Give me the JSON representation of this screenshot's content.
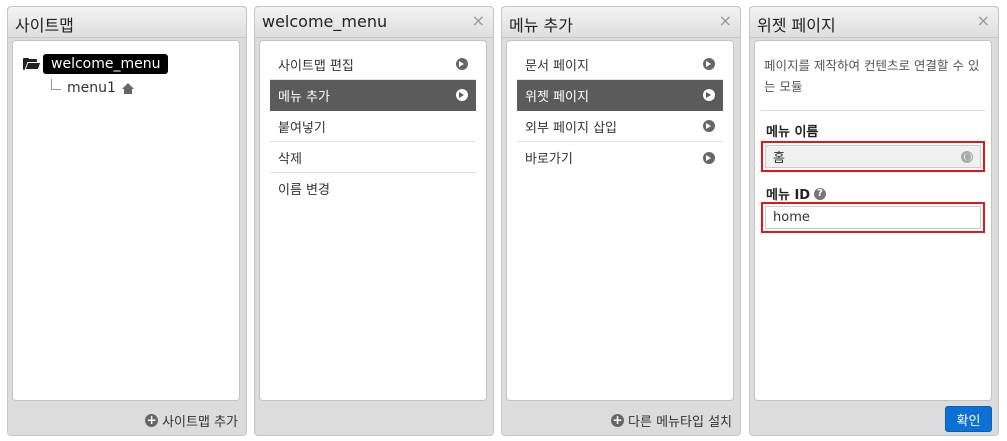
{
  "sitemap": {
    "title": "사이트맵",
    "root_label": "welcome_menu",
    "child_label": "menu1",
    "footer_action": "사이트맵 추가"
  },
  "welcome_menu_panel": {
    "title": "welcome_menu",
    "close": "×",
    "items": [
      {
        "label": "사이트맵 편집",
        "active": false
      },
      {
        "label": "메뉴 추가",
        "active": true
      },
      {
        "label": "붙여넣기",
        "active": false
      },
      {
        "label": "삭제",
        "active": false
      },
      {
        "label": "이름 변경",
        "active": false
      }
    ]
  },
  "add_menu_panel": {
    "title": "메뉴 추가",
    "close": "×",
    "items": [
      {
        "label": "문서 페이지",
        "active": false
      },
      {
        "label": "위젯 페이지",
        "active": true
      },
      {
        "label": "외부 페이지 삽입",
        "active": false
      },
      {
        "label": "바로가기",
        "active": false
      }
    ],
    "footer_action": "다른 메뉴타입 설치"
  },
  "widget_page_panel": {
    "title": "위젯 페이지",
    "close": "×",
    "description": "페이지를 제작하여 컨텐츠로 연결할 수 있는 모듈",
    "menu_name_label": "메뉴 이름",
    "menu_name_value": "홈",
    "menu_id_label": "메뉴 ID",
    "menu_id_value": "home",
    "confirm_label": "확인"
  },
  "icons": {
    "folder": "folder-open-icon",
    "home": "home-icon",
    "arrow": "arrow-right-circle-icon",
    "plus": "plus-circle-icon",
    "help": "question-circle-icon",
    "globe": "globe-icon",
    "close": "close-icon"
  },
  "colors": {
    "active_item": "#5b5b5b",
    "primary_button": "#0b71d6",
    "highlight_border": "#e01818"
  }
}
